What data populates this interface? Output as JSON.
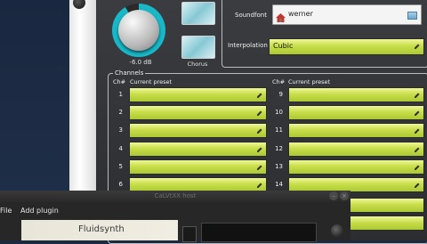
{
  "master": {
    "gain_value": "-6.0 dB"
  },
  "effects": {
    "reverb_label": "",
    "chorus_label": "Chorus"
  },
  "soundfont": {
    "label": "Soundfont",
    "value": "werner"
  },
  "interpolation": {
    "label": "Interpolation",
    "value": "Cubic"
  },
  "channels": {
    "section_label": "Channels",
    "col_ch_header": "Ch#",
    "col_preset_header": "Current preset",
    "left": [
      "1",
      "2",
      "3",
      "4",
      "5",
      "6"
    ],
    "right": [
      "9",
      "10",
      "11",
      "12",
      "13",
      "14"
    ]
  },
  "plugin_window": {
    "title": "CaLVtXX host",
    "menu_file": "File",
    "menu_add_plugin": "Add plugin",
    "plugin_name": "Fluidsynth"
  },
  "colors": {
    "accent": "#18b8c8",
    "lcd": "#c9de4a"
  }
}
